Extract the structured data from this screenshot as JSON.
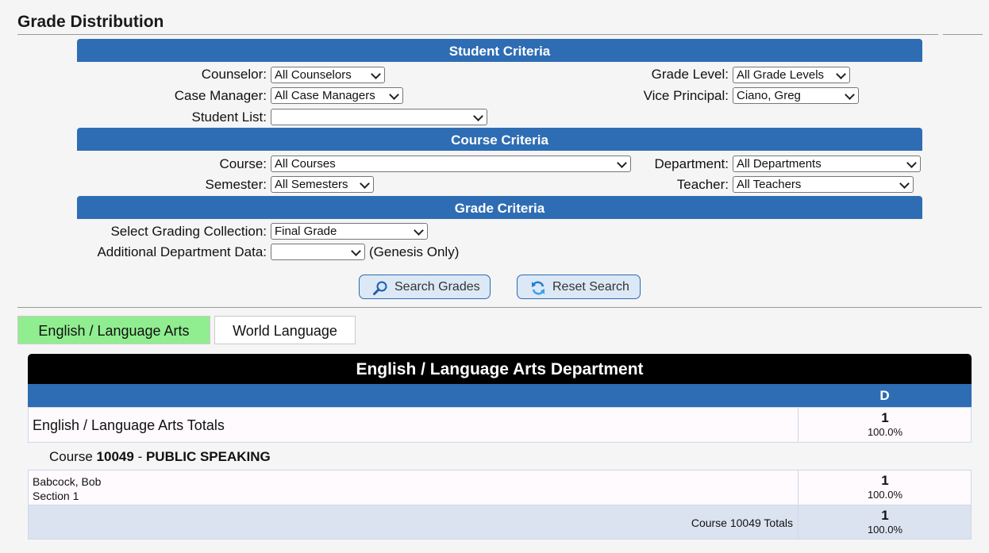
{
  "page": {
    "title": "Grade Distribution"
  },
  "student_criteria": {
    "header": "Student Criteria",
    "counselor": {
      "label": "Counselor:",
      "value": "All Counselors"
    },
    "grade_level": {
      "label": "Grade Level:",
      "value": "All Grade Levels"
    },
    "case_manager": {
      "label": "Case Manager:",
      "value": "All Case Managers"
    },
    "vice_principal": {
      "label": "Vice Principal:",
      "value": "Ciano, Greg"
    },
    "student_list": {
      "label": "Student List:",
      "value": ""
    }
  },
  "course_criteria": {
    "header": "Course Criteria",
    "course": {
      "label": "Course:",
      "value": "All Courses"
    },
    "department": {
      "label": "Department:",
      "value": "All Departments"
    },
    "semester": {
      "label": "Semester:",
      "value": "All Semesters"
    },
    "teacher": {
      "label": "Teacher:",
      "value": "All Teachers"
    }
  },
  "grade_criteria": {
    "header": "Grade Criteria",
    "grading_collection": {
      "label": "Select Grading Collection:",
      "value": "Final Grade"
    },
    "additional_dept_data": {
      "label": "Additional Department Data:",
      "value": "",
      "note": "(Genesis Only)"
    }
  },
  "buttons": {
    "search": "Search Grades",
    "reset": "Reset Search"
  },
  "tabs": [
    {
      "label": "English / Language Arts",
      "active": true
    },
    {
      "label": "World Language",
      "active": false
    }
  ],
  "results": {
    "department_title": "English / Language Arts Department",
    "grade_columns": [
      "D"
    ],
    "totals": {
      "label": "English / Language Arts Totals",
      "count": "1",
      "percent": "100.0%"
    },
    "course": {
      "prefix": "Course",
      "number": "10049",
      "separator": "-",
      "name": "PUBLIC SPEAKING",
      "sections": [
        {
          "teacher": "Babcock, Bob",
          "section": "Section 1",
          "count": "1",
          "percent": "100.0%"
        }
      ],
      "totals": {
        "label": "Course 10049 Totals",
        "count": "1",
        "percent": "100.0%"
      }
    }
  },
  "colors": {
    "band": "#2e6db4",
    "active_tab": "#90ee90",
    "course_totals_row": "#dce3f0"
  }
}
